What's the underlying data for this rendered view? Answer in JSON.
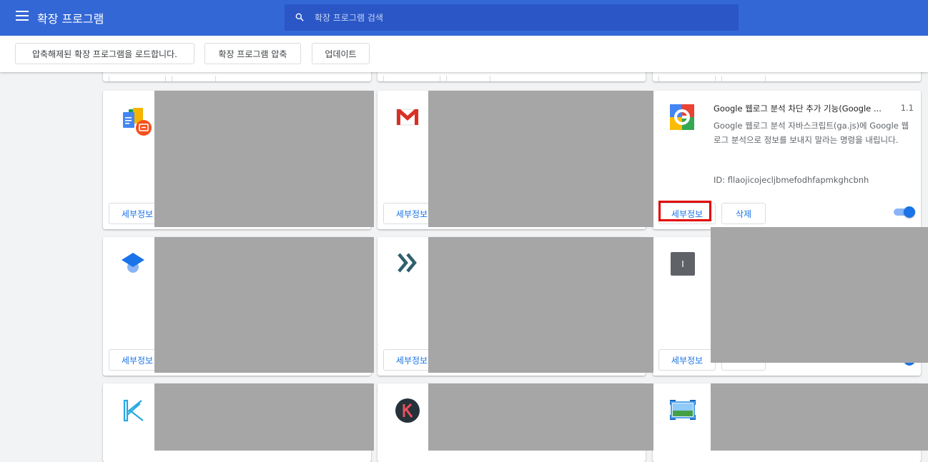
{
  "header": {
    "title": "확장 프로그램",
    "search_placeholder": "확장 프로그램 검색"
  },
  "toolbar": {
    "load_unpacked": "압축해제된 확장 프로그램을 로드합니다.",
    "pack_extension": "확장 프로그램 압축",
    "update": "업데이트"
  },
  "card_common": {
    "details_label": "세부정보",
    "remove_label": "삭제"
  },
  "featured_extension": {
    "name": "Google 웹로그 분석 차단 추가 기능(Google ...",
    "version": "1.1",
    "description": "Google 웹로그 분석 자바스크립트(ga.js)에 Google 웹로그 분석으로 정보를 보내지 말라는 명령을 내립니다.",
    "id_text": "ID: fllaojicojecljbmefodhfapmkghcbnh",
    "enabled": true
  },
  "unknown_icon_letter": "I",
  "colors": {
    "header_bg": "#3367d6",
    "search_bg": "#2a56c6",
    "accent": "#1a73e8",
    "redaction": "#a6a6a6",
    "highlight": "#e00000"
  },
  "card_icons": [
    "google-docs-offline-icon",
    "gmail-icon",
    "google-analytics-optout-icon",
    "graduation-cap-icon",
    "double-chevron-icon",
    "letter-i-icon",
    "k-pen-icon",
    "k-circle-icon",
    "screenshot-frame-icon"
  ]
}
